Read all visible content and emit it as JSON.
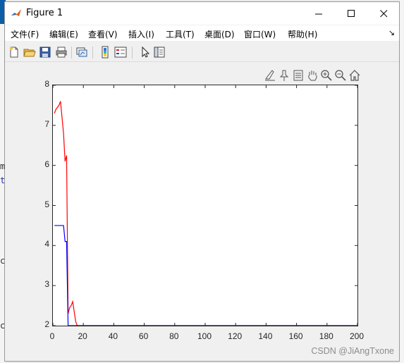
{
  "window": {
    "title": "Figure 1"
  },
  "menu": [
    "文件(F)",
    "编辑(E)",
    "查看(V)",
    "插入(I)",
    "工具(T)",
    "桌面(D)",
    "窗口(W)",
    "帮助(H)"
  ],
  "toolbar": [
    "new-figure-icon",
    "open-folder-icon",
    "save-icon",
    "print-icon",
    "link-plot-icon",
    "insert-colorbar-icon",
    "insert-legend-icon",
    "edit-plot-arrow-icon",
    "property-inspector-icon"
  ],
  "axes_toolbar": [
    "brush-icon",
    "data-tips-icon",
    "export-icon",
    "pan-hand-icon",
    "zoom-in-icon",
    "zoom-out-icon",
    "home-icon"
  ],
  "background_text": [
    "m",
    "t",
    "c",
    "c"
  ],
  "watermark": "CSDN @JiAngTxone",
  "colors": {
    "red_series": "#ff0000",
    "blue_series": "#0000ff",
    "axes": "#262626"
  },
  "chart_data": {
    "type": "line",
    "title": "",
    "xlabel": "",
    "ylabel": "",
    "xlim": [
      0,
      200
    ],
    "ylim": [
      2,
      8
    ],
    "xticks": [
      0,
      20,
      40,
      60,
      80,
      100,
      120,
      140,
      160,
      180,
      200
    ],
    "yticks": [
      2,
      3,
      4,
      5,
      6,
      7,
      8
    ],
    "grid": false,
    "series": [
      {
        "color": "#ff0000",
        "x": [
          1,
          2,
          3,
          4,
          5,
          6,
          7,
          8,
          9,
          10,
          11,
          12,
          13,
          14,
          15,
          16,
          17,
          18,
          200
        ],
        "y": [
          7.3,
          7.4,
          7.45,
          7.5,
          7.6,
          7.2,
          6.8,
          6.1,
          6.25,
          2.3,
          2.45,
          2.5,
          2.6,
          2.35,
          2.1,
          2.0,
          2.0,
          2.0,
          2.0
        ]
      },
      {
        "color": "#0000ff",
        "x": [
          1,
          2,
          3,
          4,
          5,
          6,
          7,
          8,
          9,
          10,
          200
        ],
        "y": [
          4.5,
          4.5,
          4.5,
          4.5,
          4.5,
          4.5,
          4.5,
          4.1,
          4.1,
          2.0,
          2.0
        ]
      }
    ]
  }
}
